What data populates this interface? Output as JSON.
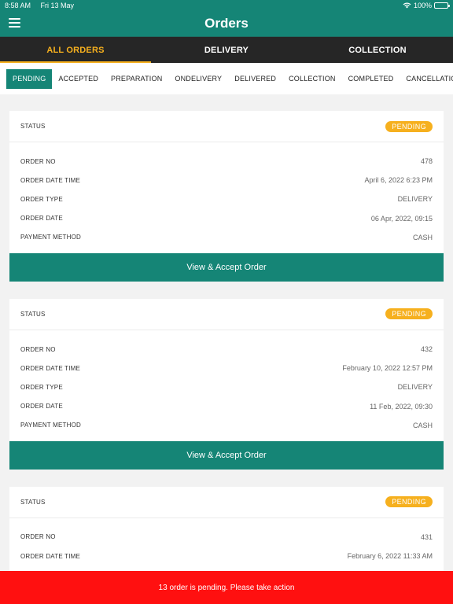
{
  "status_bar": {
    "time": "8:58 AM",
    "date": "Fri 13 May",
    "battery": "100%"
  },
  "header": {
    "title": "Orders"
  },
  "main_tabs": [
    "ALL ORDERS",
    "DELIVERY",
    "COLLECTION"
  ],
  "sub_tabs": [
    "PENDING",
    "ACCEPTED",
    "PREPARATION",
    "ONDELIVERY",
    "DELIVERED",
    "COLLECTION",
    "COMPLETED",
    "CANCELLATION"
  ],
  "labels": {
    "status": "STATUS",
    "order_no": "ORDER NO",
    "order_date_time": "ORDER DATE TIME",
    "order_type": "ORDER TYPE",
    "order_date": "ORDER DATE",
    "payment_method": "PAYMENT METHOD",
    "accept_button": "View & Accept Order"
  },
  "orders": [
    {
      "status": "PENDING",
      "order_no": "478",
      "order_date_time": "April 6, 2022 6:23 PM",
      "order_type": "DELIVERY",
      "order_date": "06 Apr, 2022, 09:15",
      "payment_method": "CASH"
    },
    {
      "status": "PENDING",
      "order_no": "432",
      "order_date_time": "February 10, 2022 12:57 PM",
      "order_type": "DELIVERY",
      "order_date": "11 Feb, 2022, 09:30",
      "payment_method": "CASH"
    },
    {
      "status": "PENDING",
      "order_no": "431",
      "order_date_time": "February 6, 2022 11:33 AM"
    }
  ],
  "alert": {
    "message": "13 order is pending. Please take action"
  },
  "colors": {
    "primary": "#158576",
    "accent": "#f6b01e",
    "alert": "#ff1010",
    "tabbar": "#262626"
  }
}
